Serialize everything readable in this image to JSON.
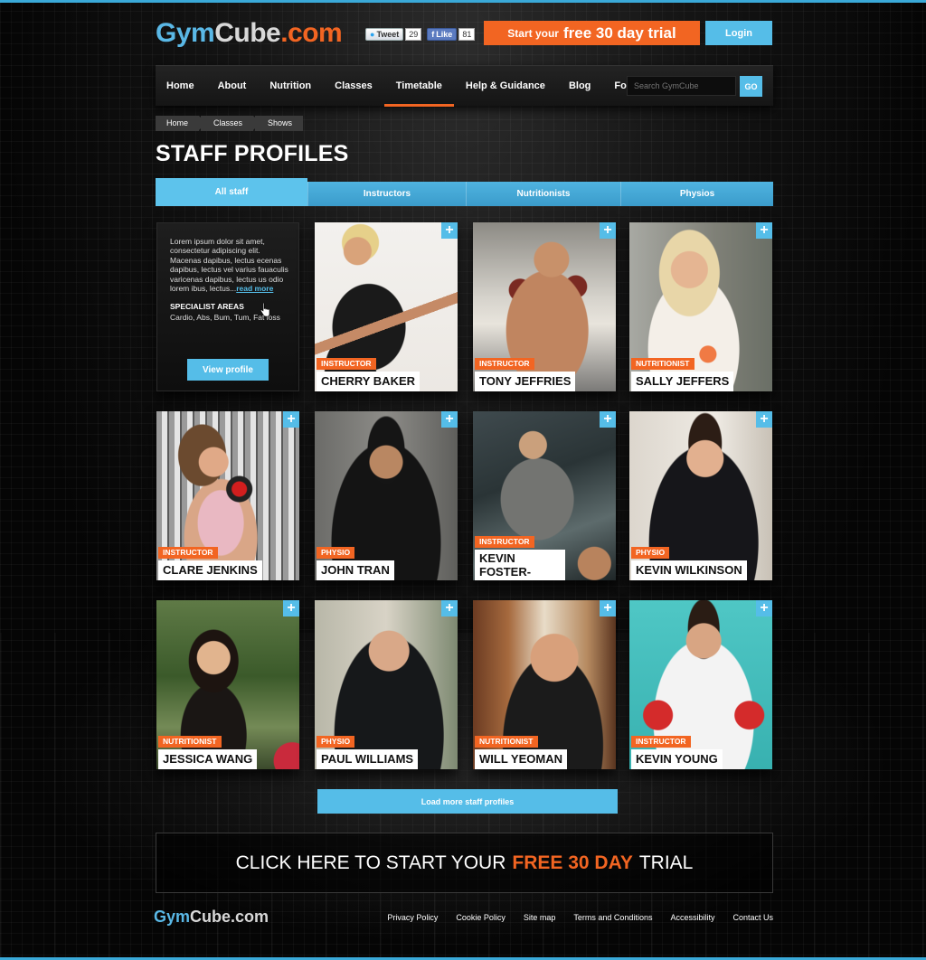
{
  "header": {
    "logo": {
      "part1": "Gym",
      "part2": "Cube",
      "part3": ".com"
    },
    "social": {
      "tweet_label": "Tweet",
      "tweet_count": "29",
      "like_label": "Like",
      "like_count": "81"
    },
    "trial_button": {
      "prefix": "Start your",
      "emphasis": "free 30 day trial"
    },
    "login_label": "Login"
  },
  "nav": {
    "items": [
      "Home",
      "About",
      "Nutrition",
      "Classes",
      "Timetable",
      "Help & Guidance",
      "Blog",
      "Forum"
    ],
    "active": "Timetable",
    "search_placeholder": "Search GymCube",
    "search_go": "GO"
  },
  "breadcrumb": [
    "Home",
    "Classes",
    "Shows"
  ],
  "page_title": "STAFF PROFILES",
  "tabs": {
    "items": [
      "All staff",
      "Instructors",
      "Nutritionists",
      "Physios"
    ],
    "active": "All staff"
  },
  "info_card": {
    "text": "Lorem ipsum dolor sit amet, consectetur adipiscing elit. Macenas dapibus, lectus ecenas dapibus, lectus vel varius fauaculis varicenas dapibus, lectus us odio lorem ibus, lectus...",
    "read_more": "read more",
    "specialist_heading": "SPECIALIST AREAS",
    "specialist_list": "Cardio, Abs, Bum, Tum, Fat loss",
    "view_profile": "View profile"
  },
  "staff": [
    {
      "role": "INSTRUCTOR",
      "name": "CHERRY BAKER"
    },
    {
      "role": "INSTRUCTOR",
      "name": "TONY JEFFRIES"
    },
    {
      "role": "NUTRITIONIST",
      "name": "SALLY JEFFERS"
    },
    {
      "role": "INSTRUCTOR",
      "name": "CLARE JENKINS"
    },
    {
      "role": "PHYSIO",
      "name": "JOHN TRAN"
    },
    {
      "role": "INSTRUCTOR",
      "name": "KEVIN FOSTER-WILTSHIRE"
    },
    {
      "role": "PHYSIO",
      "name": "KEVIN WILKINSON"
    },
    {
      "role": "NUTRITIONIST",
      "name": "JESSICA WANG"
    },
    {
      "role": "PHYSIO",
      "name": "PAUL WILLIAMS"
    },
    {
      "role": "NUTRITIONIST",
      "name": "WILL YEOMAN"
    },
    {
      "role": "INSTRUCTOR",
      "name": "KEVIN YOUNG"
    }
  ],
  "load_more": "Load more staff profiles",
  "cta": {
    "prefix": "CLICK HERE TO START YOUR",
    "emphasis": "FREE 30 DAY",
    "suffix": "TRIAL"
  },
  "footer": {
    "logo": {
      "part1": "Gym",
      "part2": "Cube",
      "part3": ".com"
    },
    "links": [
      "Privacy Policy",
      "Cookie Policy",
      "Site map",
      "Terms and Conditions",
      "Accessibility",
      "Contact Us"
    ]
  },
  "colors": {
    "accent_blue": "#55bde8",
    "accent_orange": "#f26522",
    "background": "#0a0a0a"
  }
}
